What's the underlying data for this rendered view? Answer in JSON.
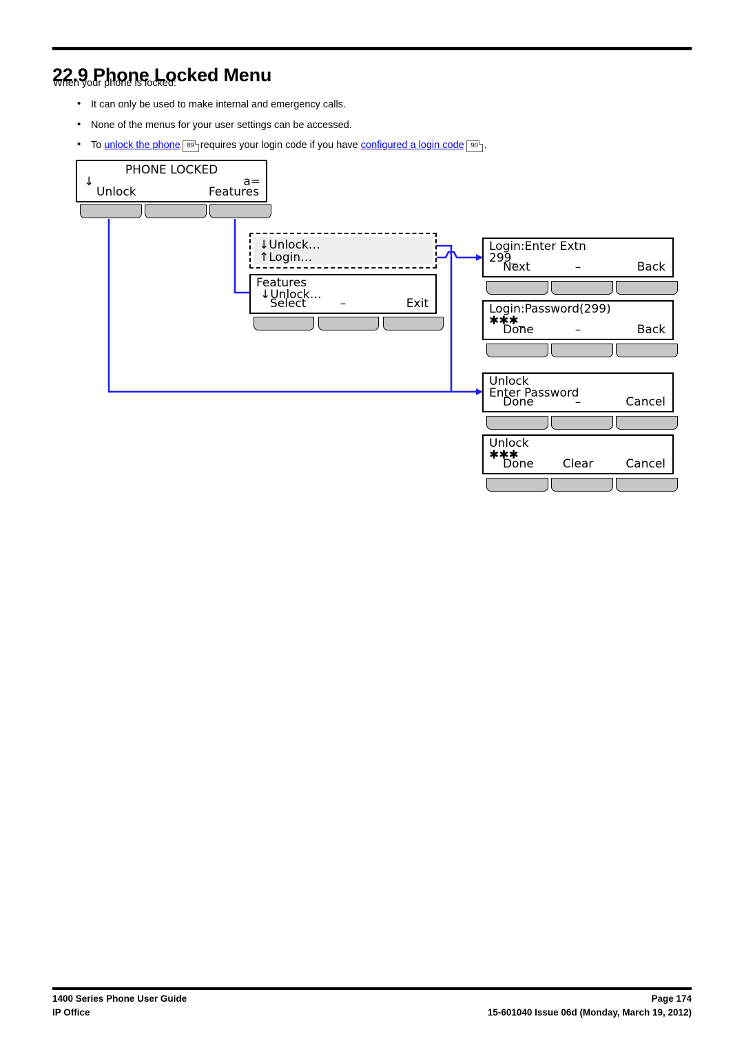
{
  "document": {
    "heading": "22.9 Phone Locked Menu",
    "intro": "When your phone is locked:",
    "bullets": {
      "b1": "It can only be used to make internal and emergency calls.",
      "b2": "None of the menus for your user settings can be accessed.",
      "b3_pre": "To ",
      "b3_link1": "unlock the phone",
      "b3_ref1": "89",
      "b3_mid": "requires your login code if you have ",
      "b3_link2": "configured a login code",
      "b3_ref2": "90",
      "b3_post": "."
    },
    "bullet_glyph": "•"
  },
  "colors": {
    "link": "#0000ee",
    "connector": "#2020ee",
    "key_fill": "#c6c6c6",
    "highlight_fill": "#eeeeee",
    "ink": "#000000"
  },
  "diagram": {
    "screens": [
      {
        "id": "phone-locked",
        "title": "PHONE LOCKED",
        "indicator_down": "↓",
        "indicator_mode": "a=",
        "line_left": "Unlock",
        "line_right": "Features"
      },
      {
        "id": "unlock-login-highlight",
        "line1": "↓Unlock…",
        "line2": "↑Login…"
      },
      {
        "id": "features-menu",
        "line1": "Features",
        "line2": "↓Unlock…",
        "soft_a": "Select",
        "soft_b": "–",
        "soft_c": "Exit"
      },
      {
        "id": "login-enter-extn",
        "line1": "Login:Enter Extn",
        "line2": "299_",
        "soft_a": "Next",
        "soft_b": "–",
        "soft_c": "Back"
      },
      {
        "id": "login-password",
        "line1": "Login:Password(299)",
        "line2": "✱✱✱_",
        "soft_a": "Done",
        "soft_b": "–",
        "soft_c": "Back"
      },
      {
        "id": "unlock-enter-password",
        "line1": "Unlock",
        "line2": "Enter Password",
        "soft_a": "Done",
        "soft_b": "–",
        "soft_c": "Cancel"
      },
      {
        "id": "unlock-password-entered",
        "line1": "Unlock",
        "line2": "✱✱✱",
        "soft_a": "Done",
        "soft_b": "Clear",
        "soft_c": "Cancel"
      }
    ]
  },
  "footer": {
    "left_line1": "1400 Series Phone User Guide",
    "left_line2": "IP Office",
    "right_line1": "Page 174",
    "right_line2": "15-601040 Issue 06d (Monday, March 19, 2012)"
  }
}
